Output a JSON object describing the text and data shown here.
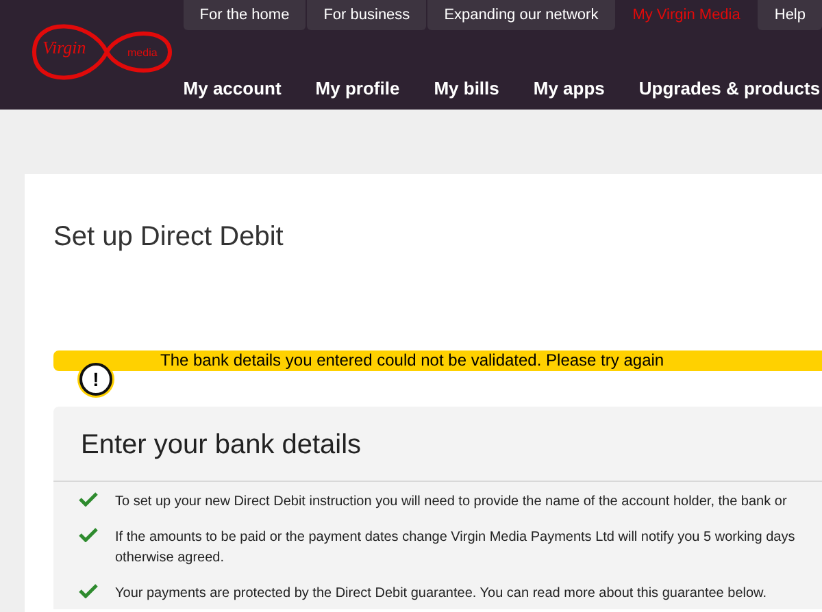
{
  "logo": {
    "word": "Virgin",
    "sub": "media"
  },
  "top_tabs": [
    {
      "label": "For the home",
      "selected": false
    },
    {
      "label": "For business",
      "selected": false
    },
    {
      "label": "Expanding our network",
      "selected": false
    },
    {
      "label": "My Virgin Media",
      "selected": true
    },
    {
      "label": "Help",
      "selected": false
    }
  ],
  "main_nav": [
    "My account",
    "My profile",
    "My bills",
    "My apps",
    "Upgrades & products"
  ],
  "page_title": "Set up Direct Debit",
  "alert": {
    "icon": "!",
    "message": "The bank details you entered could not be validated. Please try again"
  },
  "panel": {
    "title": "Enter your bank details",
    "items": [
      "To set up your new Direct Debit instruction you will need to provide the name of the account holder, the bank or",
      "If the amounts to be paid or the payment dates change Virgin Media Payments Ltd will notify you 5 working days\notherwise agreed.",
      "Your payments are protected by the Direct Debit guarantee. You can read more about this guarantee below."
    ]
  }
}
